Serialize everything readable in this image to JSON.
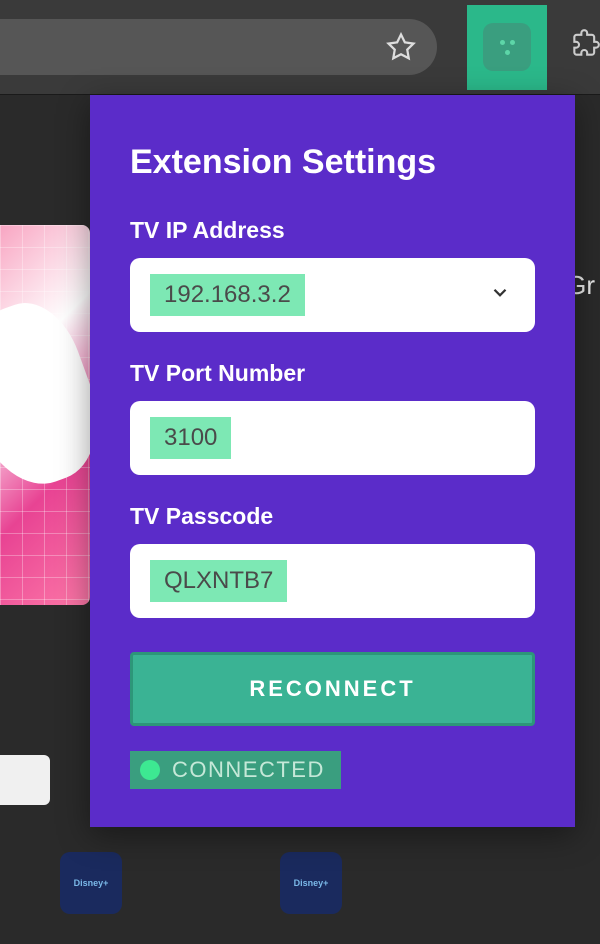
{
  "popup": {
    "title": "Extension Settings",
    "fields": {
      "ip": {
        "label": "TV IP Address",
        "value": "192.168.3.2"
      },
      "port": {
        "label": "TV Port Number",
        "value": "3100"
      },
      "passcode": {
        "label": "TV Passcode",
        "value": "QLXNTB7"
      }
    },
    "reconnect_label": "RECONNECT",
    "status": {
      "text": "CONNECTED"
    }
  },
  "background": {
    "partial_text": "Gr",
    "app_label": "Disney+"
  }
}
